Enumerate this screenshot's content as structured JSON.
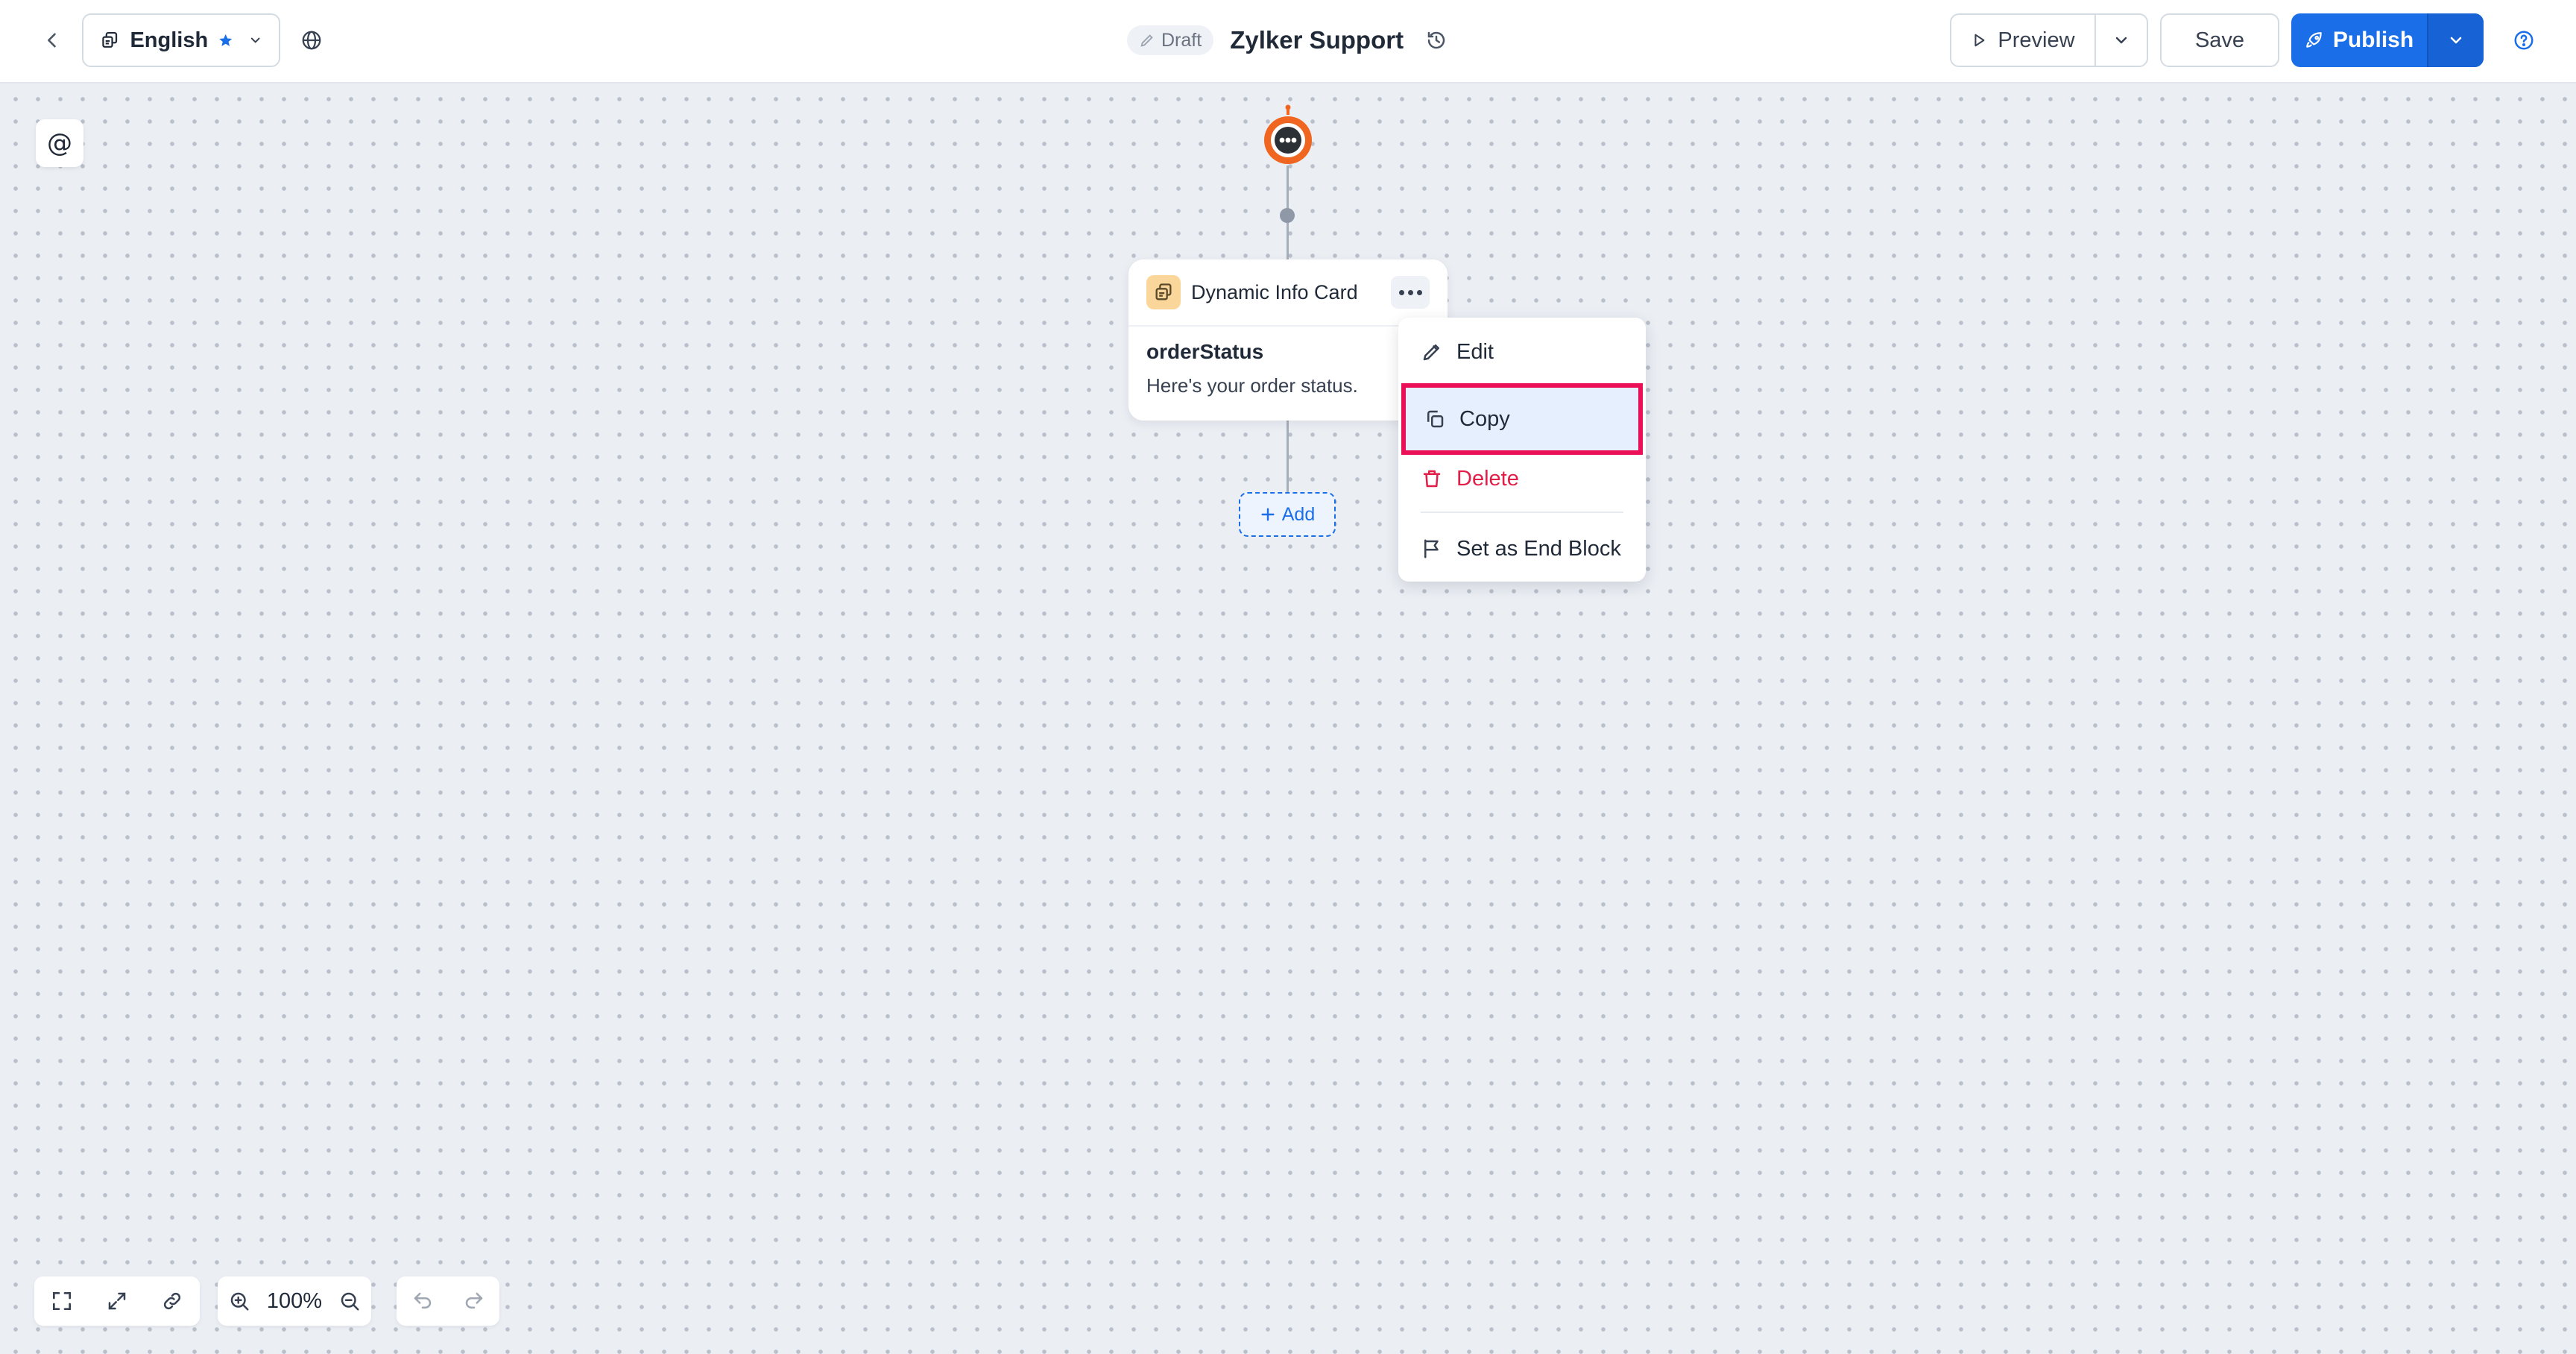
{
  "header": {
    "language": "English",
    "draft_label": "Draft",
    "bot_name": "Zylker Support",
    "preview_label": "Preview",
    "save_label": "Save",
    "publish_label": "Publish"
  },
  "canvas": {
    "mention_symbol": "@",
    "node": {
      "title": "Dynamic Info Card",
      "name": "orderStatus",
      "description": "Here's your order status."
    },
    "add_label": "Add"
  },
  "context_menu": {
    "items": [
      {
        "label": "Edit"
      },
      {
        "label": "Copy"
      },
      {
        "label": "Delete"
      },
      {
        "label": "Set as End Block"
      }
    ]
  },
  "toolbar": {
    "zoom_level": "100%"
  },
  "colors": {
    "accent": "#1a6ee8",
    "danger": "#e11d48",
    "highlight": "#ea0f56",
    "bot": "#f0651f"
  }
}
